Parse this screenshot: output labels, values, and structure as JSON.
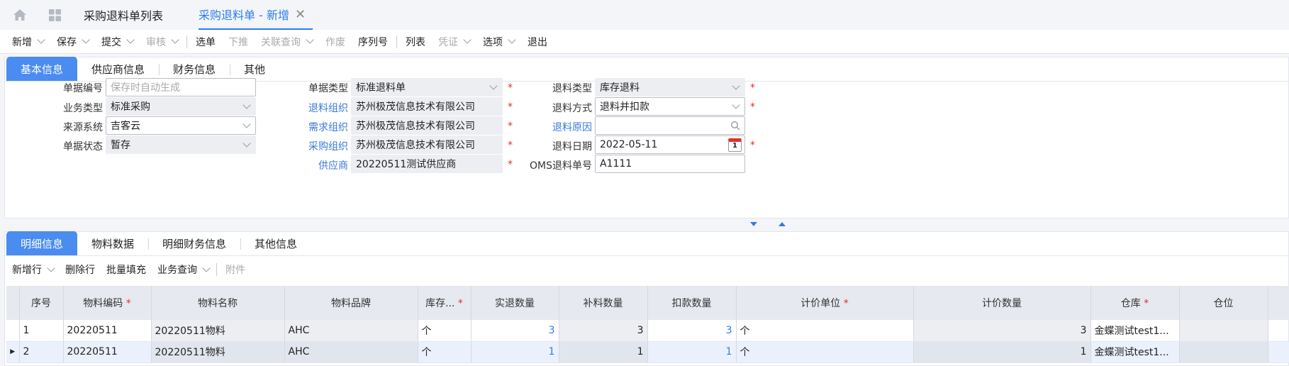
{
  "tabs": {
    "list": "采购退料单列表",
    "current": "采购退料单 - 新增",
    "close": "✕"
  },
  "toolbar": [
    {
      "label": "新增",
      "caret": true,
      "disabled": false
    },
    {
      "label": "保存",
      "caret": true,
      "disabled": false
    },
    {
      "label": "提交",
      "caret": true,
      "disabled": false
    },
    {
      "label": "审核",
      "caret": true,
      "disabled": true
    },
    {
      "sep": true
    },
    {
      "label": "选单",
      "caret": false,
      "disabled": false
    },
    {
      "label": "下推",
      "caret": false,
      "disabled": true
    },
    {
      "label": "关联查询",
      "caret": true,
      "disabled": true
    },
    {
      "label": "作废",
      "caret": false,
      "disabled": true
    },
    {
      "label": "序列号",
      "caret": false,
      "disabled": false
    },
    {
      "sep": true
    },
    {
      "label": "列表",
      "caret": false,
      "disabled": false
    },
    {
      "label": "凭证",
      "caret": true,
      "disabled": true
    },
    {
      "label": "选项",
      "caret": true,
      "disabled": false
    },
    {
      "label": "退出",
      "caret": false,
      "disabled": false
    }
  ],
  "header_tabs": [
    "基本信息",
    "供应商信息",
    "财务信息",
    "其他"
  ],
  "form": {
    "bill_no": {
      "label": "单据编号",
      "placeholder": "保存时自动生成"
    },
    "biz_type": {
      "label": "业务类型",
      "value": "标准采购"
    },
    "source_sys": {
      "label": "来源系统",
      "value": "吉客云"
    },
    "bill_status": {
      "label": "单据状态",
      "value": "暂存"
    },
    "bill_type": {
      "label": "单据类型",
      "value": "标准退料单"
    },
    "return_org": {
      "label": "退料组织",
      "value": "苏州极茂信息技术有限公司"
    },
    "demand_org": {
      "label": "需求组织",
      "value": "苏州极茂信息技术有限公司"
    },
    "purchase_org": {
      "label": "采购组织",
      "value": "苏州极茂信息技术有限公司"
    },
    "supplier": {
      "label": "供应商",
      "value": "20220511测试供应商"
    },
    "return_type": {
      "label": "退料类型",
      "value": "库存退料"
    },
    "return_method": {
      "label": "退料方式",
      "value": "退料并扣款"
    },
    "return_reason": {
      "label": "退料原因",
      "value": ""
    },
    "return_date": {
      "label": "退料日期",
      "value": "2022-05-11",
      "calendar_day": "1"
    },
    "oms_no": {
      "label": "OMS退料单号",
      "value": "A1111"
    },
    "required_mark": "*"
  },
  "detail_tabs": [
    "明细信息",
    "物料数据",
    "明细财务信息",
    "其他信息"
  ],
  "detail_toolbar": [
    {
      "label": "新增行",
      "caret": true,
      "disabled": false
    },
    {
      "label": "删除行",
      "caret": false,
      "disabled": false
    },
    {
      "label": "批量填充",
      "caret": false,
      "disabled": false
    },
    {
      "label": "业务查询",
      "caret": true,
      "disabled": false
    },
    {
      "sep": true
    },
    {
      "label": "附件",
      "caret": false,
      "disabled": true
    }
  ],
  "grid": {
    "columns": [
      {
        "label": "",
        "req": false
      },
      {
        "label": "序号",
        "req": false
      },
      {
        "label": "物料编码",
        "req": true
      },
      {
        "label": "物料名称",
        "req": false
      },
      {
        "label": "物料品牌",
        "req": false
      },
      {
        "label": "库存...",
        "req": true
      },
      {
        "label": "实退数量",
        "req": false
      },
      {
        "label": "补料数量",
        "req": false
      },
      {
        "label": "扣款数量",
        "req": false
      },
      {
        "label": "计价单位",
        "req": true
      },
      {
        "label": "计价数量",
        "req": false
      },
      {
        "label": "仓库",
        "req": true
      },
      {
        "label": "仓位",
        "req": false
      },
      {
        "label": "",
        "req": false
      }
    ],
    "rows": [
      {
        "marker": "",
        "seq": "1",
        "code": "20220511",
        "name": "20220511物料",
        "brand": "AHC",
        "stock_unit": "个",
        "return_qty": "3",
        "supply_qty": "3",
        "deduct_qty": "3",
        "price_unit": "个",
        "price_qty": "3",
        "warehouse": "金蝶测试test1...",
        "location": ""
      },
      {
        "marker": "▶",
        "seq": "2",
        "code": "20220511",
        "name": "20220511物料",
        "brand": "AHC",
        "stock_unit": "个",
        "return_qty": "1",
        "supply_qty": "1",
        "deduct_qty": "1",
        "price_unit": "个",
        "price_qty": "1",
        "warehouse": "金蝶测试test1...",
        "location": ""
      }
    ]
  },
  "colors": {
    "accent": "#2b7de9",
    "tab_active": "#4a8cf0",
    "required": "#e03030",
    "link": "#3b78d8"
  }
}
